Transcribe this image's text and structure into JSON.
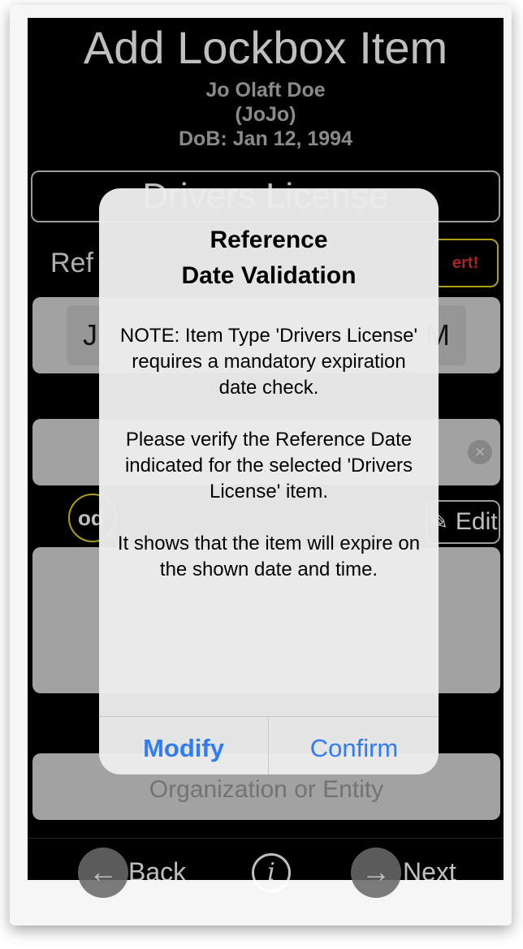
{
  "screen": {
    "title": "Add Lockbox Item",
    "person_name": "Jo Olaft Doe",
    "person_nick": "(JoJo)",
    "person_dob": "DoB: Jan 12, 1994",
    "type_field_value": "Drivers License",
    "ref_label": "Ref",
    "alert_button": "ert!",
    "date_value_left": "J",
    "date_value_right": "M",
    "od_button": "od",
    "edit_button": "Edit",
    "org_placeholder": "Organization or Entity",
    "back_label": "Back",
    "next_label": "Next"
  },
  "dialog": {
    "title_line1": "Reference",
    "title_line2": "Date Validation",
    "message": [
      "NOTE: Item Type 'Drivers License' requires a mandatory expiration date check.",
      "Please verify the Reference Date indicated for the selected 'Drivers License' item.",
      "It shows that the item will expire on the shown date and time."
    ],
    "modify_label": "Modify",
    "confirm_label": "Confirm"
  },
  "colors": {
    "screen_bg": "#000000",
    "field_bg": "#d9d9d9",
    "accent_blue": "#2f7cf6",
    "alert_yellow": "#e7d21a",
    "alert_red": "#e03030"
  }
}
